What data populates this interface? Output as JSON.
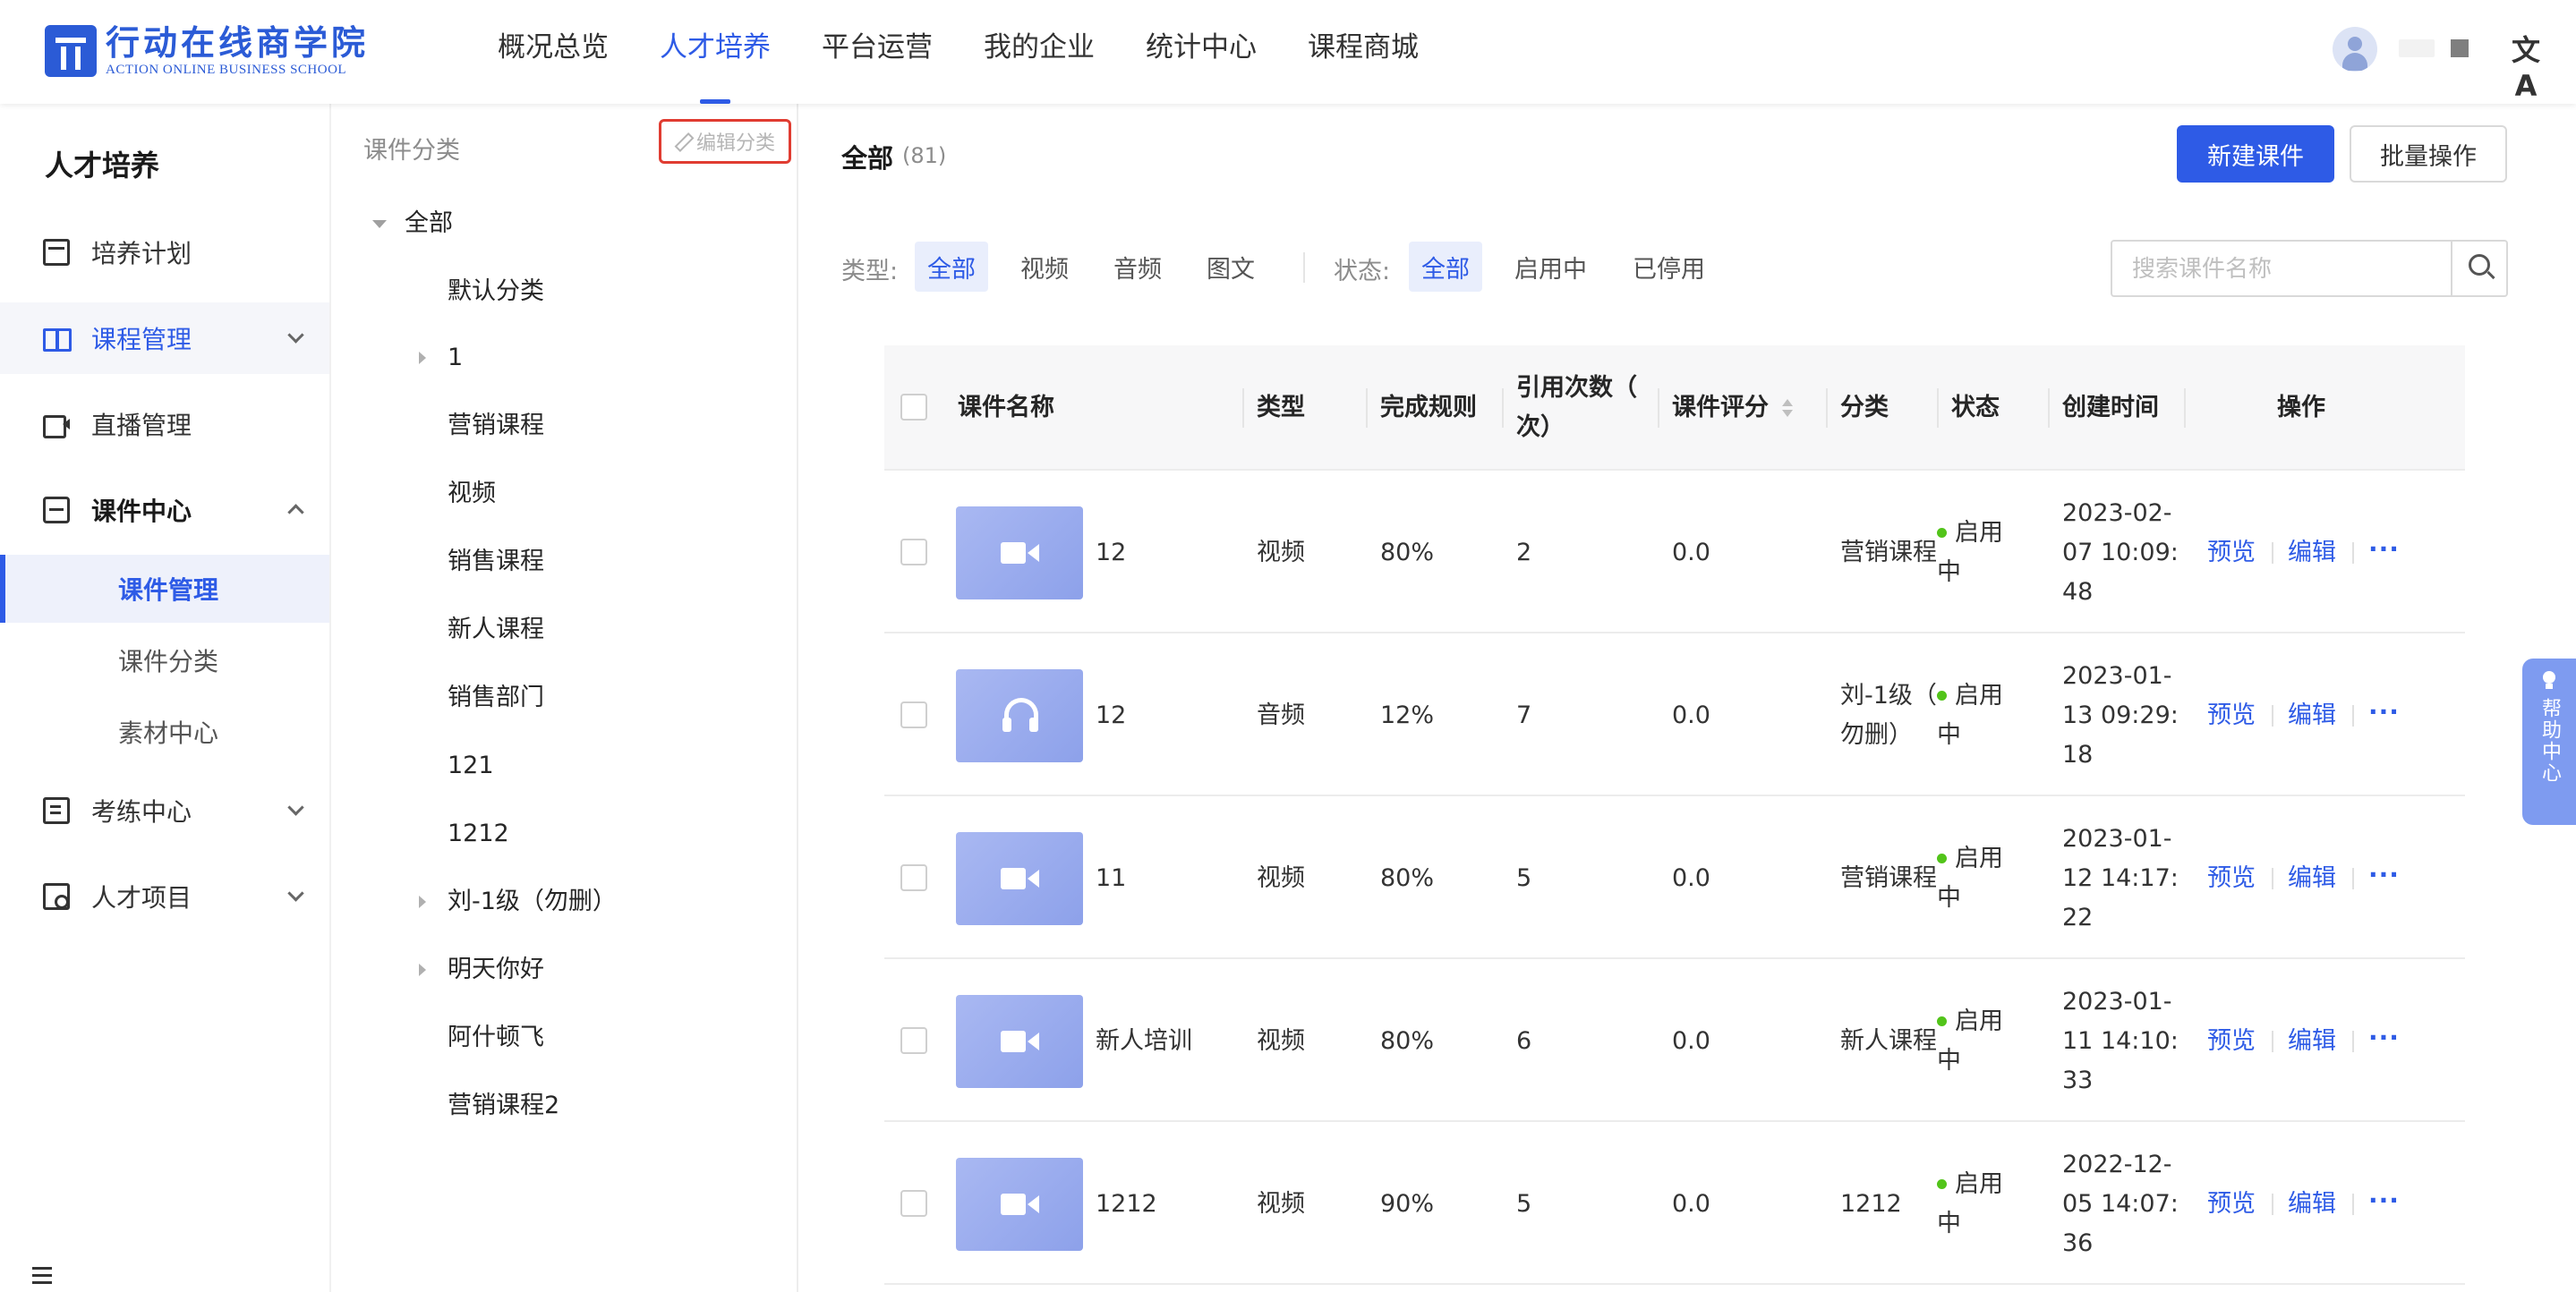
{
  "brand": {
    "name_cn": "行动在线商学院",
    "name_en": "ACTION ONLINE BUSINESS SCHOOL",
    "color": "#2b5bd6"
  },
  "nav": {
    "items": [
      "概况总览",
      "人才培养",
      "平台运营",
      "我的企业",
      "统计中心",
      "课程商城"
    ],
    "active": "人才培养",
    "accent": "#2e5be6"
  },
  "header_right": {
    "avatar_icon": "user-avatar",
    "language_icon": "translate-icon",
    "language_glyph": "文A"
  },
  "sidebar": {
    "title": "人才培养",
    "items": [
      {
        "label": "培养计划",
        "icon": "calendar-icon"
      },
      {
        "label": "课程管理",
        "icon": "book-icon"
      },
      {
        "label": "直播管理",
        "icon": "video-camera-icon"
      },
      {
        "label": "课件中心",
        "icon": "inbox-icon"
      },
      {
        "label": "考练中心",
        "icon": "exam-icon"
      },
      {
        "label": "人才项目",
        "icon": "project-icon"
      }
    ],
    "sub_items": [
      "课件管理",
      "课件分类",
      "素材中心"
    ],
    "active_sub": "课件管理"
  },
  "category_panel": {
    "header": "课件分类",
    "edit_label": "编辑分类",
    "root": "全部",
    "nodes": [
      "默认分类",
      "1",
      "营销课程",
      "视频",
      "销售课程",
      "新人课程",
      "销售部门",
      "121",
      "1212",
      "刘-1级（勿删）",
      "明天你好",
      "阿什顿飞",
      "营销课程2"
    ]
  },
  "main": {
    "title": "全部",
    "count": "(81)",
    "new_button": "新建课件",
    "batch_button": "批量操作",
    "type_label": "类型:",
    "type_options": [
      "全部",
      "视频",
      "音频",
      "图文"
    ],
    "status_label": "状态:",
    "status_options": [
      "全部",
      "启用中",
      "已停用"
    ],
    "search_placeholder": "搜索课件名称"
  },
  "table": {
    "headers": {
      "name": "课件名称",
      "type": "类型",
      "rule": "完成规则",
      "refs_line1": "引用次数（",
      "refs_line2": "次）",
      "score": "课件评分",
      "category": "分类",
      "status": "状态",
      "created": "创建时间",
      "ops": "操作"
    },
    "rows": [
      {
        "thumb": "video",
        "name": "12",
        "type": "视频",
        "rule": "80%",
        "refs": "2",
        "score": "0.0",
        "category_l1": "营销课程",
        "category_l2": "",
        "status_l1": "启用",
        "status_l2": "中",
        "created_l1": "2023-02-",
        "created_l2": "07 10:09:",
        "created_l3": "48",
        "preview": "预览",
        "edit": "编辑",
        "more": "···"
      },
      {
        "thumb": "audio",
        "name": "12",
        "type": "音频",
        "rule": "12%",
        "refs": "7",
        "score": "0.0",
        "category_l1": "刘-1级（",
        "category_l2": "勿删）",
        "status_l1": "启用",
        "status_l2": "中",
        "created_l1": "2023-01-",
        "created_l2": "13 09:29:",
        "created_l3": "18",
        "preview": "预览",
        "edit": "编辑",
        "more": "···"
      },
      {
        "thumb": "video",
        "name": "11",
        "type": "视频",
        "rule": "80%",
        "refs": "5",
        "score": "0.0",
        "category_l1": "营销课程",
        "category_l2": "",
        "status_l1": "启用",
        "status_l2": "中",
        "created_l1": "2023-01-",
        "created_l2": "12 14:17:",
        "created_l3": "22",
        "preview": "预览",
        "edit": "编辑",
        "more": "···"
      },
      {
        "thumb": "video",
        "name": "新人培训",
        "type": "视频",
        "rule": "80%",
        "refs": "6",
        "score": "0.0",
        "category_l1": "新人课程",
        "category_l2": "",
        "status_l1": "启用",
        "status_l2": "中",
        "created_l1": "2023-01-",
        "created_l2": "11 14:10:",
        "created_l3": "33",
        "preview": "预览",
        "edit": "编辑",
        "more": "···"
      },
      {
        "thumb": "video",
        "name": "1212",
        "type": "视频",
        "rule": "90%",
        "refs": "5",
        "score": "0.0",
        "category_l1": "1212",
        "category_l2": "",
        "status_l1": "启用",
        "status_l2": "中",
        "created_l1": "2022-12-",
        "created_l2": "05 14:07:",
        "created_l3": "36",
        "preview": "预览",
        "edit": "编辑",
        "more": "···"
      }
    ]
  },
  "help": {
    "label": "帮助中心"
  }
}
